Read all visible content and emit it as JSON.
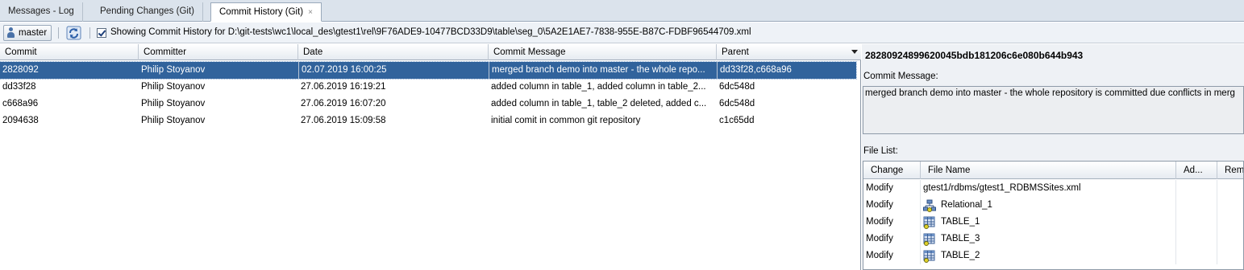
{
  "tabs": [
    {
      "label": "Messages - Log",
      "active": false
    },
    {
      "label": "Pending Changes (Git)",
      "active": false
    },
    {
      "label": "Commit History (Git)",
      "active": true,
      "close": "×"
    }
  ],
  "toolbar": {
    "branch_label": "master",
    "checkbox_checked": true,
    "history_text": "Showing Commit History for D:\\git-tests\\wc1\\local_des\\gtest1\\rel\\9F76ADE9-10477BCD33D9\\table\\seg_0\\5A2E1AE7-7838-955E-B87C-FDBF96544709.xml"
  },
  "commit_table": {
    "columns": [
      "Commit",
      "Committer",
      "Date",
      "Commit Message",
      "Parent"
    ],
    "rows": [
      {
        "commit": "2828092",
        "committer": "Philip Stoyanov",
        "date": "02.07.2019 16:00:25",
        "message": "merged branch demo into master - the whole repo...",
        "parent": "dd33f28,c668a96",
        "selected": true
      },
      {
        "commit": "dd33f28",
        "committer": "Philip Stoyanov",
        "date": "27.06.2019 16:19:21",
        "message": "added column in table_1, added column  in table_2...",
        "parent": "6dc548d",
        "selected": false
      },
      {
        "commit": "c668a96",
        "committer": "Philip Stoyanov",
        "date": "27.06.2019 16:07:20",
        "message": "added column in table_1, table_2 deleted, added c...",
        "parent": "6dc548d",
        "selected": false
      },
      {
        "commit": "2094638",
        "committer": "Philip Stoyanov",
        "date": "27.06.2019 15:09:58",
        "message": "initial comit in common git repository",
        "parent": "c1c65dd",
        "selected": false
      }
    ]
  },
  "detail": {
    "commit_hash": "28280924899620045bdb181206c6e080b644b943",
    "commit_message_label": "Commit Message:",
    "commit_message": "merged branch demo into master - the whole repository is committed due conflicts in merg",
    "file_list_label": "File List:",
    "file_columns": [
      "Change",
      "File Name",
      "Ad...",
      "Remo"
    ],
    "files": [
      {
        "change": "Modify",
        "name": "gtest1/rdbms/gtest1_RDBMSSites.xml",
        "icon": "none"
      },
      {
        "change": "Modify",
        "name": "Relational_1",
        "icon": "relational-model-icon"
      },
      {
        "change": "Modify",
        "name": "TABLE_1",
        "icon": "table-icon"
      },
      {
        "change": "Modify",
        "name": "TABLE_3",
        "icon": "table-icon"
      },
      {
        "change": "Modify",
        "name": "TABLE_2",
        "icon": "table-icon"
      }
    ]
  }
}
